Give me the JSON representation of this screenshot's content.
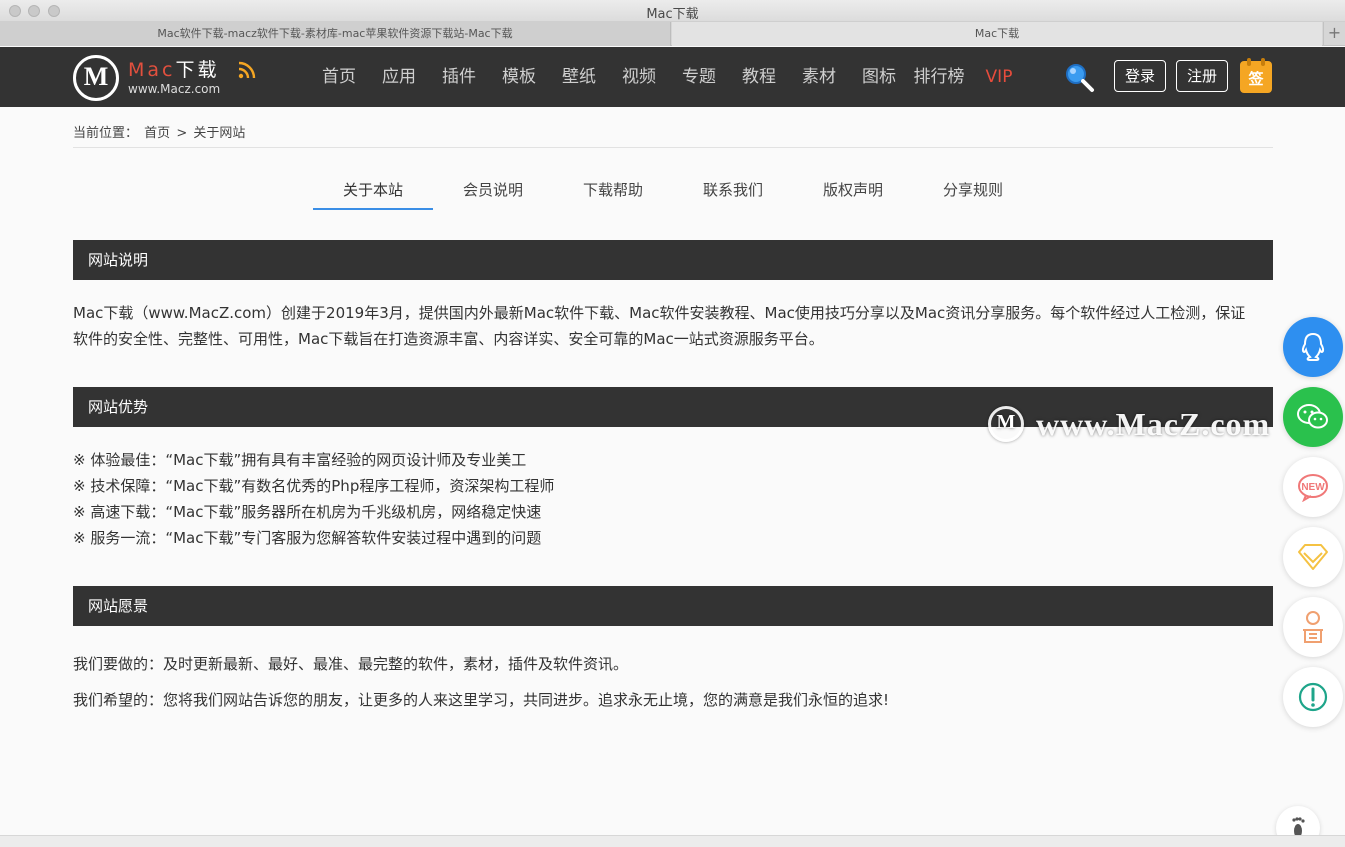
{
  "window": {
    "title": "Mac下载"
  },
  "tabs": [
    {
      "label": "Mac软件下载-macz软件下载-素材库-mac苹果软件资源下载站-Mac下载"
    },
    {
      "label": "Mac下载"
    }
  ],
  "header": {
    "logo_mac": "Mac",
    "logo_dl": "下载",
    "logo_url": "www.Macz.com",
    "nav": [
      "首页",
      "应用",
      "插件",
      "模板",
      "壁纸",
      "视频",
      "专题",
      "教程",
      "素材",
      "图标",
      "排行榜",
      "VIP"
    ],
    "login": "登录",
    "register": "注册",
    "sign": "签"
  },
  "breadcrumb": {
    "prefix": "当前位置：",
    "home": "首页",
    "sep": ">",
    "current": "关于网站"
  },
  "subtabs": [
    "关于本站",
    "会员说明",
    "下载帮助",
    "联系我们",
    "版权声明",
    "分享规则"
  ],
  "sections": {
    "intro_title": "网站说明",
    "intro_text": "Mac下载（www.MacZ.com）创建于2019年3月，提供国内外最新Mac软件下载、Mac软件安装教程、Mac使用技巧分享以及Mac资讯分享服务。每个软件经过人工检测，保证软件的安全性、完整性、可用性，Mac下载旨在打造资源丰富、内容详实、安全可靠的Mac一站式资源服务平台。",
    "adv_title": "网站优势",
    "adv_items": [
      "※ 体验最佳：“Mac下载”拥有具有丰富经验的网页设计师及专业美工",
      "※ 技术保障：“Mac下载”有数名优秀的Php程序工程师，资深架构工程师",
      "※ 高速下载：“Mac下载”服务器所在机房为千兆级机房，网络稳定快速",
      "※ 服务一流：“Mac下载”专门客服为您解答软件安装过程中遇到的问题"
    ],
    "vision_title": "网站愿景",
    "vision_items": [
      "我们要做的：及时更新最新、最好、最准、最完整的软件，素材，插件及软件资讯。",
      "我们希望的：您将我们网站告诉您的朋友，让更多的人来这里学习，共同进步。追求永无止境，您的满意是我们永恒的追求!"
    ]
  },
  "watermark": {
    "text": "www.MacZ.com"
  },
  "float_badges": {
    "new": "NEW"
  },
  "colors": {
    "header_bg": "#333333",
    "accent": "#3a8ee6",
    "vip": "#e74c3c",
    "logo_red": "#e2503e"
  }
}
